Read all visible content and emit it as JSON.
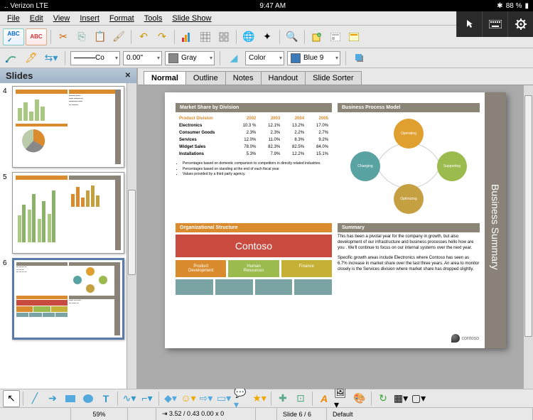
{
  "status": {
    "carrier": ".. Verizon  LTE",
    "time": "9:47 AM",
    "battery": "88 %",
    "bt": "⋮"
  },
  "menu": [
    "File",
    "Edit",
    "View",
    "Insert",
    "Format",
    "Tools",
    "Slide Show"
  ],
  "toolbar2": {
    "combo1": "Co",
    "width": "0.00\"",
    "color1_label": "Gray",
    "color2_label": "Color",
    "color3_label": "Blue 9"
  },
  "slides_panel": {
    "title": "Slides",
    "close": "✕"
  },
  "view_tabs": [
    "Normal",
    "Outline",
    "Notes",
    "Handout",
    "Slide Sorter"
  ],
  "active_tab": 0,
  "thumbs": [
    4,
    5,
    6
  ],
  "selected_thumb": 6,
  "slide": {
    "side_title": "Business Summary",
    "market": {
      "header": "Market Share by Division",
      "cols": [
        "Product Division",
        "2002",
        "2003",
        "2004",
        "2005"
      ],
      "rows": [
        [
          "Electronics",
          "10.3 %",
          "12.1%",
          "13.2%",
          "17.0%"
        ],
        [
          "Consumer Goods",
          "2.3%",
          "2.3%",
          "2.2%",
          "2.7%"
        ],
        [
          "Services",
          "12.0%",
          "11.0%",
          "8.3%",
          "9.2%"
        ],
        [
          "Widget Sales",
          "78.0%",
          "82.3%",
          "82.5%",
          "84.0%"
        ],
        [
          "Installations",
          "5.3%",
          "7.9%",
          "12.2%",
          "15.1%"
        ]
      ],
      "bullets": [
        "Percentages based on domestic comparison to competitors in directly related industries.",
        "Percentages based on standing at the end of each fiscal year.",
        "Values provided by a third party agency."
      ]
    },
    "process": {
      "header": "Business Process Model",
      "circles": [
        {
          "label": "Operating",
          "color": "#e0a030"
        },
        {
          "label": "Changing",
          "color": "#5aa3a3"
        },
        {
          "label": "Supporting",
          "color": "#9bbb4e"
        },
        {
          "label": "Optimizing",
          "color": "#c5a040"
        }
      ]
    },
    "org": {
      "header": "Organizational Structure",
      "top": "Contoso",
      "row1": [
        {
          "l1": "Product",
          "l2": "Development",
          "c": "#d98b2e"
        },
        {
          "l1": "Human",
          "l2": "Resources",
          "c": "#9bbb4e"
        },
        {
          "l1": "Finance",
          "l2": "",
          "c": "#c5b135"
        }
      ],
      "row2": [
        {
          "c": "#7aa3a3"
        },
        {
          "c": "#7aa3a3"
        },
        {
          "c": "#7aa3a3"
        },
        {
          "c": "#7aa3a3"
        }
      ]
    },
    "summary": {
      "header": "Summary",
      "p1": "This has been a pivotal year for the company in growth, but also development of our infrastructure and business processes hello how are you . We'll continue to focus on our internal systems over the next year.",
      "p2": "Specific growth areas include Electronics where Contoso has seen as 6.7% increase in market share over the last three years. An area to monitor closely is the Services division where market share has dropped slightly."
    },
    "logo": "contoso"
  },
  "app_status": {
    "zoom": "59%",
    "coords": "⇥ 3.52 / 0.43   0.00 x 0",
    "slide": "Slide 6 / 6",
    "layout": "Default"
  }
}
